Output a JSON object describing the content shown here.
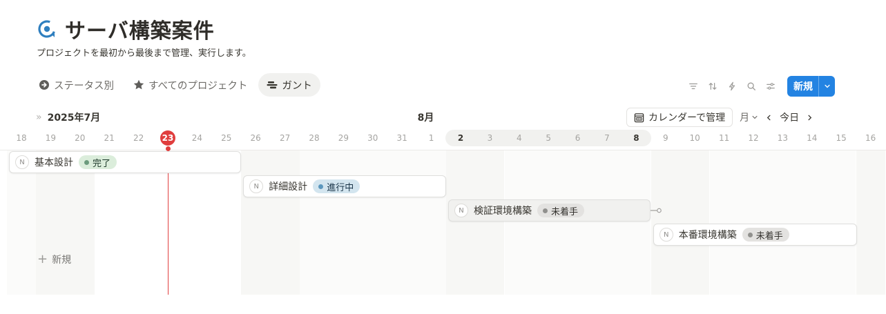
{
  "page": {
    "title": "サーバ構築案件",
    "description": "プロジェクトを最初から最後まで管理、実行します。",
    "icon": "refresh-target-icon",
    "accent_color": "#2383e2",
    "today_color": "#e03e3e"
  },
  "views": [
    {
      "label": "ステータス別",
      "icon": "arrow-circle-icon",
      "active": false
    },
    {
      "label": "すべてのプロジェクト",
      "icon": "star-icon",
      "active": false
    },
    {
      "label": "ガント",
      "icon": "timeline-icon",
      "active": true
    }
  ],
  "toolbar": {
    "icons": [
      "filter-icon",
      "sort-icon",
      "automation-icon",
      "search-icon",
      "settings-icon"
    ],
    "new_label": "新規"
  },
  "timeline": {
    "current_month": "2025年7月",
    "next_month": "8月",
    "calendar_button": "カレンダーで管理",
    "scale": "月",
    "today_button": "今日",
    "today": "23",
    "days": [
      "18",
      "19",
      "20",
      "21",
      "22",
      "23",
      "24",
      "25",
      "26",
      "27",
      "28",
      "29",
      "30",
      "31",
      "1",
      "2",
      "3",
      "4",
      "5",
      "6",
      "7",
      "8",
      "9",
      "10",
      "11",
      "12",
      "13",
      "14",
      "15",
      "16"
    ],
    "bold_days": [
      "2",
      "8"
    ]
  },
  "tasks": [
    {
      "icon": "N",
      "name": "基本設計",
      "status": "完了",
      "status_color": "#dbeddb",
      "dot_color": "#6c9b7d",
      "text_color": "#1c3829",
      "gray": false
    },
    {
      "icon": "N",
      "name": "詳細設計",
      "status": "進行中",
      "status_color": "#d3e5ef",
      "dot_color": "#5b97bd",
      "text_color": "#183347",
      "gray": false
    },
    {
      "icon": "N",
      "name": "検証環境構築",
      "status": "未着手",
      "status_color": "#e3e2e0",
      "dot_color": "#91918e",
      "text_color": "#32302c",
      "gray": true
    },
    {
      "icon": "N",
      "name": "本番環境構築",
      "status": "未着手",
      "status_color": "#e3e2e0",
      "dot_color": "#91918e",
      "text_color": "#32302c",
      "gray": false
    }
  ],
  "add_new_label": "新規"
}
